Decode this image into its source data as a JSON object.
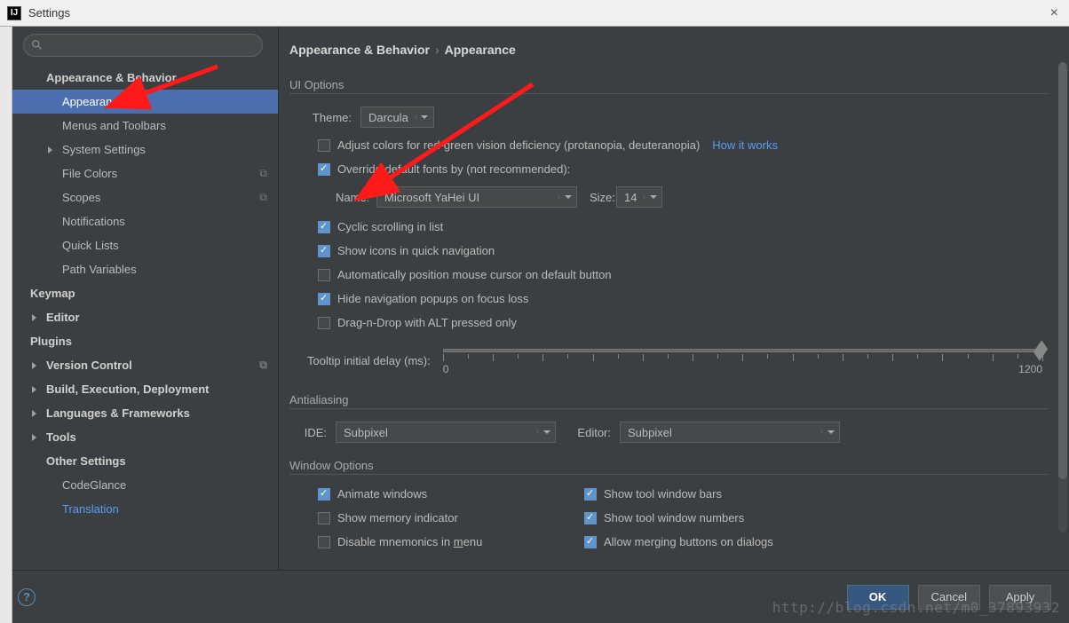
{
  "window": {
    "title": "Settings"
  },
  "breadcrumb": {
    "group": "Appearance & Behavior",
    "page": "Appearance"
  },
  "sidebar": {
    "items": [
      {
        "label": "Appearance & Behavior"
      },
      {
        "label": "Appearance"
      },
      {
        "label": "Menus and Toolbars"
      },
      {
        "label": "System Settings"
      },
      {
        "label": "File Colors"
      },
      {
        "label": "Scopes"
      },
      {
        "label": "Notifications"
      },
      {
        "label": "Quick Lists"
      },
      {
        "label": "Path Variables"
      },
      {
        "label": "Keymap"
      },
      {
        "label": "Editor"
      },
      {
        "label": "Plugins"
      },
      {
        "label": "Version Control"
      },
      {
        "label": "Build, Execution, Deployment"
      },
      {
        "label": "Languages & Frameworks"
      },
      {
        "label": "Tools"
      },
      {
        "label": "Other Settings"
      },
      {
        "label": "CodeGlance"
      },
      {
        "label": "Translation"
      }
    ]
  },
  "ui_options": {
    "heading": "UI Options",
    "theme_label": "Theme:",
    "theme_value": "Darcula",
    "adjust_colors": "Adjust colors for red-green vision deficiency (protanopia, deuteranopia)",
    "how_it_works": "How it works",
    "override_fonts": "Override default fonts by (not recommended):",
    "name_label": "Name:",
    "name_value": "Microsoft YaHei UI",
    "size_label": "Size:",
    "size_value": "14",
    "cyclic": "Cyclic scrolling in list",
    "show_icons": "Show icons in quick navigation",
    "auto_mouse": "Automatically position mouse cursor on default button",
    "hide_nav": "Hide navigation popups on focus loss",
    "drag": "Drag-n-Drop with ALT pressed only",
    "tooltip_label": "Tooltip initial delay (ms):",
    "tooltip_min": "0",
    "tooltip_max": "1200"
  },
  "antialiasing": {
    "heading": "Antialiasing",
    "ide_label": "IDE:",
    "ide_value": "Subpixel",
    "editor_label": "Editor:",
    "editor_value": "Subpixel"
  },
  "window_options": {
    "heading": "Window Options",
    "animate": "Animate windows",
    "memory": "Show memory indicator",
    "mnemonics_pre": "Disable mnemonics in ",
    "mnemonics_u": "m",
    "mnemonics_post": "enu",
    "toolbars": "Show tool window bars",
    "numbers": "Show tool window numbers",
    "merge": "Allow merging buttons on dialogs"
  },
  "footer": {
    "ok": "OK",
    "cancel": "Cancel",
    "apply": "Apply"
  },
  "watermark": "http://blog.csdn.net/m0_37893932"
}
